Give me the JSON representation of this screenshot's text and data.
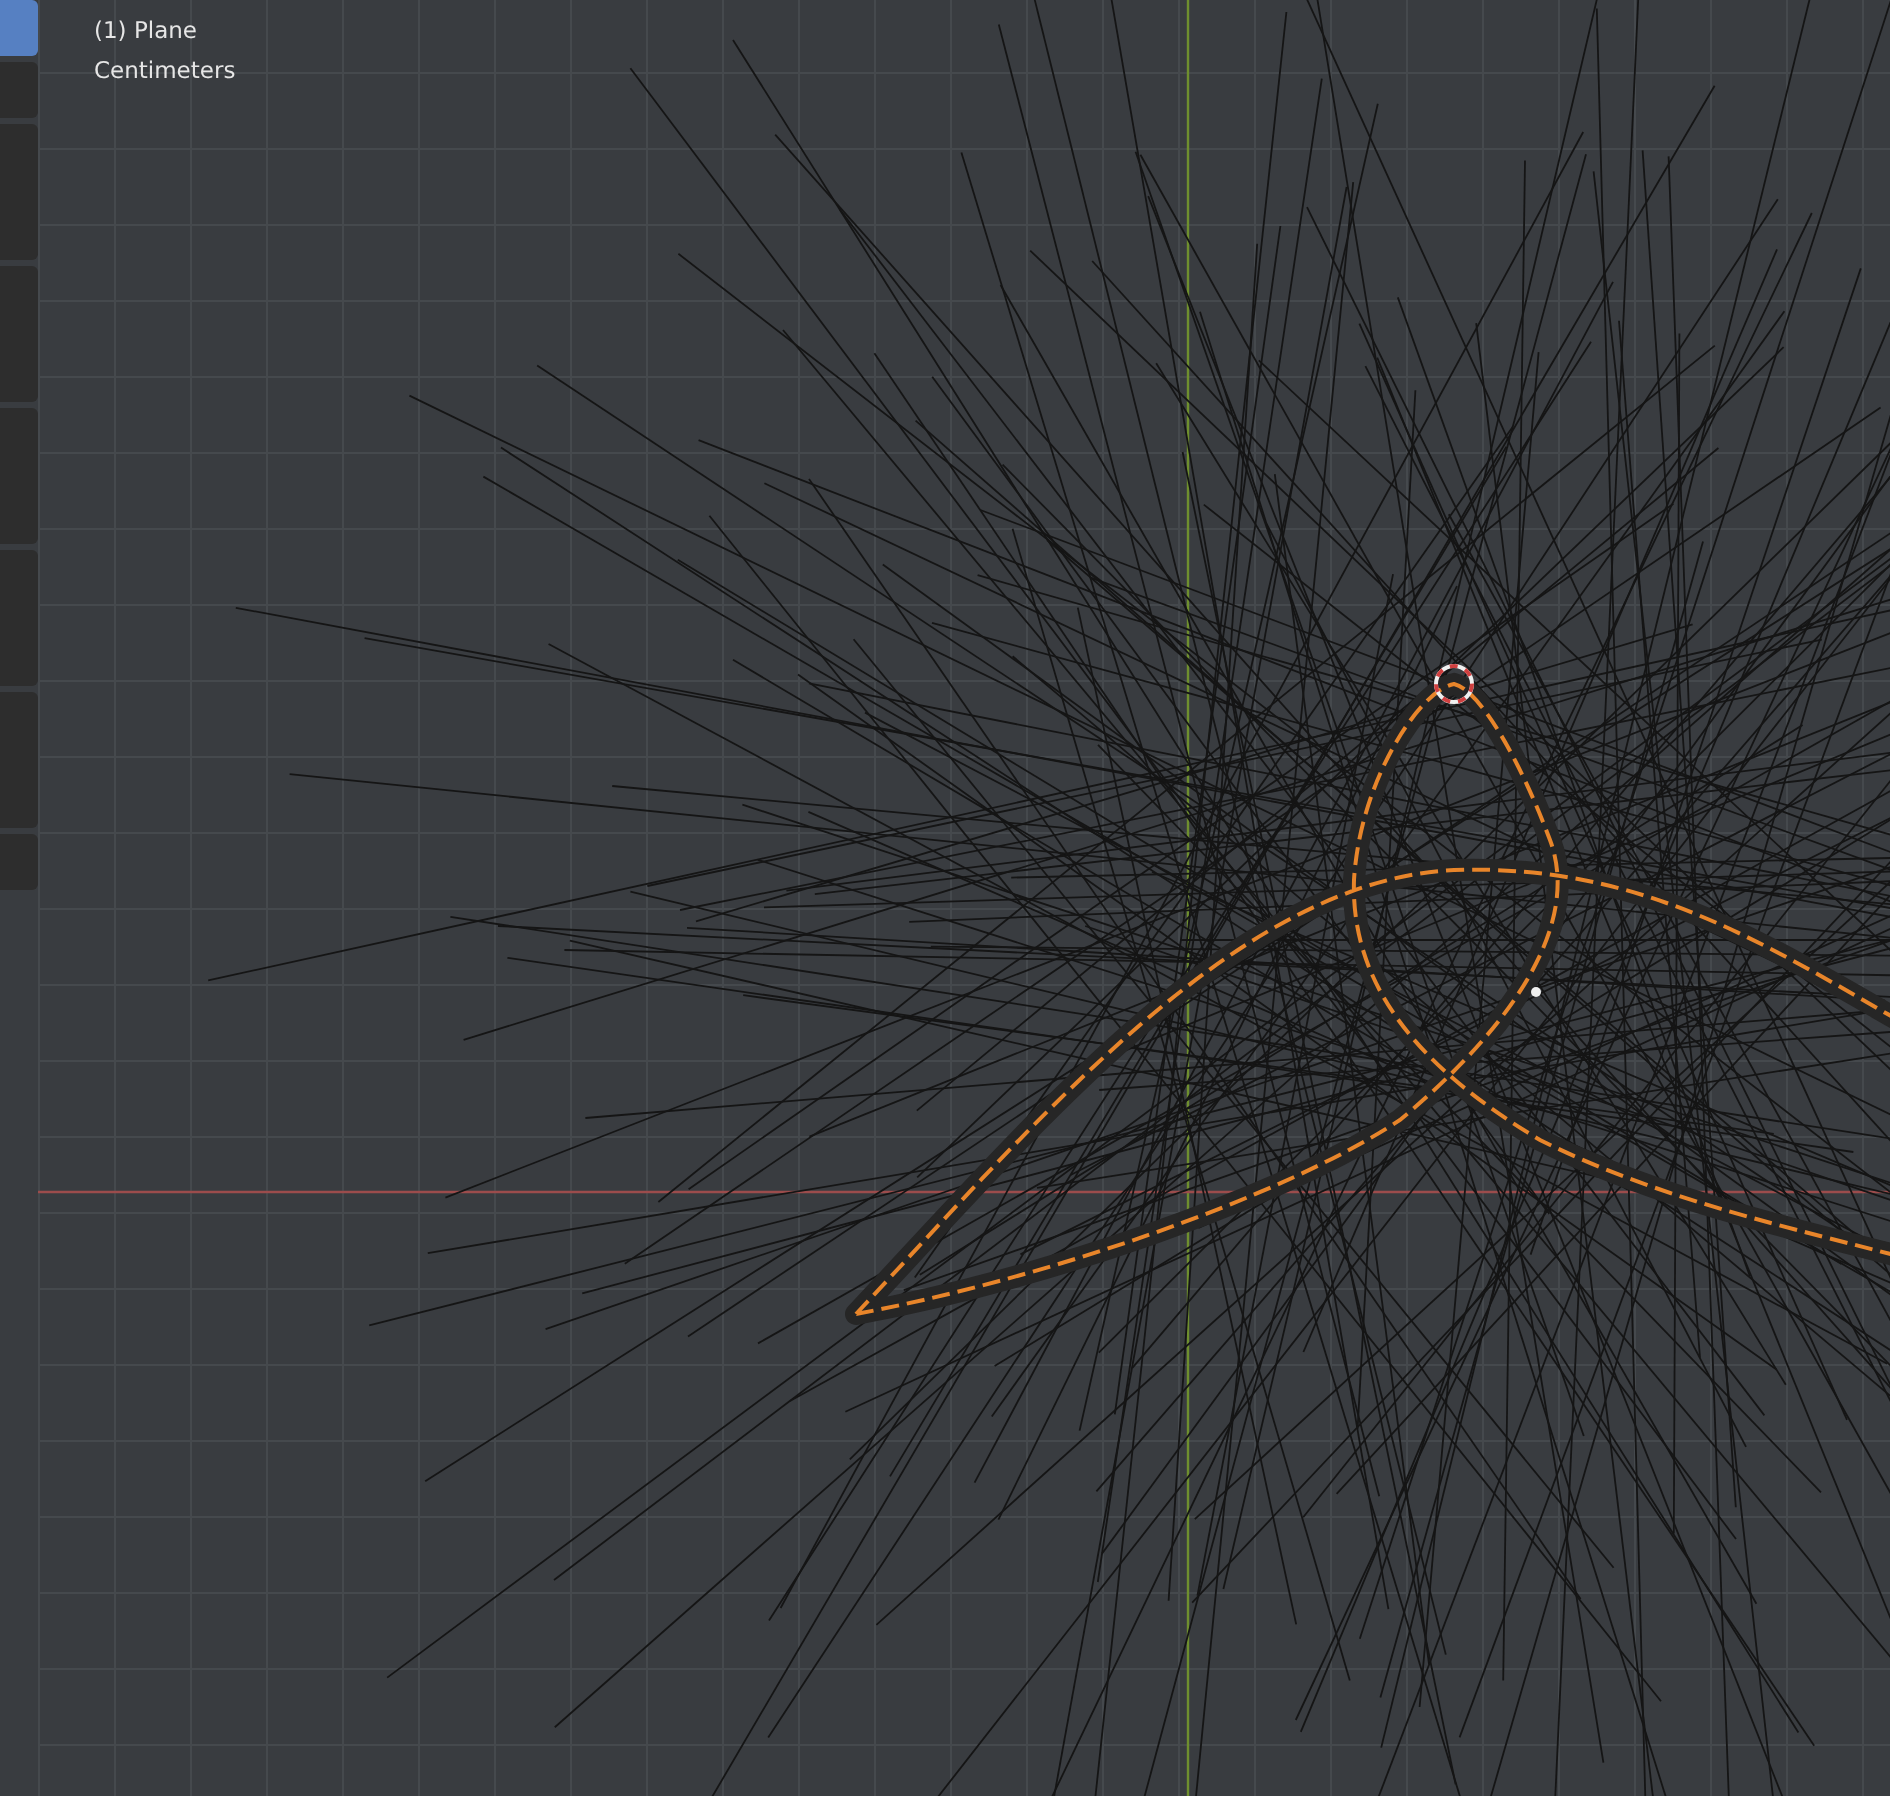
{
  "toolbar_tabs": [
    {
      "selected": true,
      "kind": "button"
    },
    {
      "selected": false,
      "kind": "button"
    },
    {
      "selected": false,
      "kind": "panel"
    },
    {
      "selected": false,
      "kind": "panel"
    },
    {
      "selected": false,
      "kind": "panel"
    },
    {
      "selected": false,
      "kind": "panel"
    },
    {
      "selected": false,
      "kind": "panel"
    },
    {
      "selected": false,
      "kind": "button"
    }
  ],
  "viewport": {
    "object_label": "(1) Plane",
    "units": "Centimeters"
  }
}
